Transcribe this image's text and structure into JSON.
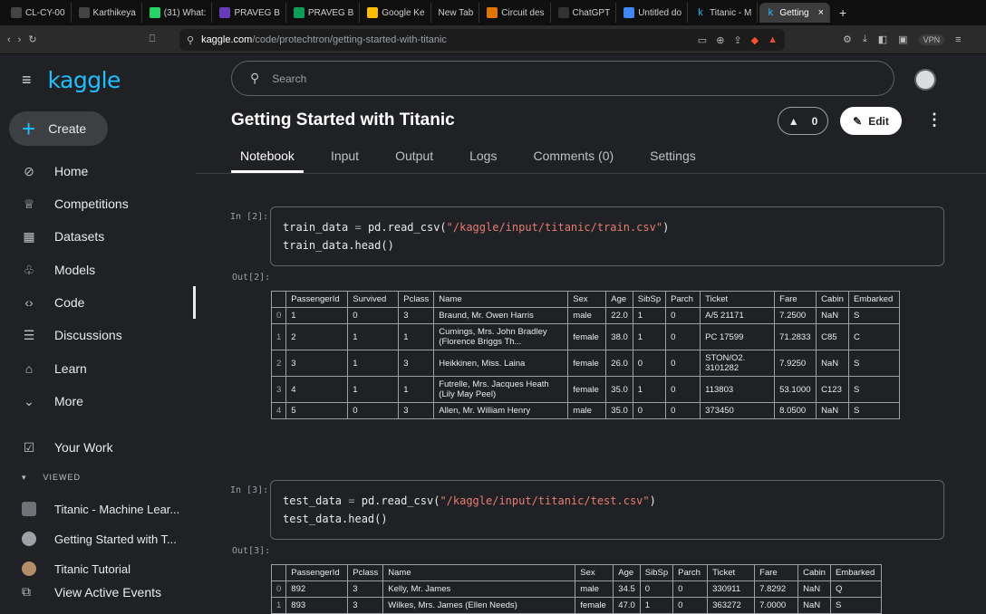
{
  "browser": {
    "tabs": [
      {
        "label": "CL-CY-00",
        "icon": "github-icon",
        "color": "#444"
      },
      {
        "label": "Karthikeya",
        "icon": "github-icon",
        "color": "#444"
      },
      {
        "label": "(31) What:",
        "icon": "whatsapp-icon",
        "color": "#25d366"
      },
      {
        "label": "PRAVEG B",
        "icon": "forms-icon",
        "color": "#673ab7"
      },
      {
        "label": "PRAVEG B",
        "icon": "sheets-icon",
        "color": "#0f9d58"
      },
      {
        "label": "Google Ke",
        "icon": "keep-icon",
        "color": "#fbbc04"
      },
      {
        "label": "New Tab",
        "icon": "",
        "color": ""
      },
      {
        "label": "Circuit des",
        "icon": "circuit-icon",
        "color": "#e37400"
      },
      {
        "label": "ChatGPT",
        "icon": "chatgpt-icon",
        "color": "#333"
      },
      {
        "label": "Untitled do",
        "icon": "docs-icon",
        "color": "#4285f4"
      },
      {
        "label": "Titanic - M",
        "icon": "kaggle-icon",
        "color": ""
      },
      {
        "label": "Getting",
        "icon": "kaggle-icon",
        "color": ""
      }
    ],
    "url_host": "kaggle.com",
    "url_path": "/code/protechtron/getting-started-with-titanic",
    "vpn_label": "VPN"
  },
  "sidebar": {
    "logo": "kaggle",
    "create_label": "Create",
    "items": [
      {
        "label": "Home",
        "icon": "compass-icon",
        "glyph": "⊘"
      },
      {
        "label": "Competitions",
        "icon": "trophy-icon",
        "glyph": "♕"
      },
      {
        "label": "Datasets",
        "icon": "table-icon",
        "glyph": "▦"
      },
      {
        "label": "Models",
        "icon": "models-icon",
        "glyph": "♧"
      },
      {
        "label": "Code",
        "icon": "code-icon",
        "glyph": "‹›"
      },
      {
        "label": "Discussions",
        "icon": "discussion-icon",
        "glyph": "☰"
      },
      {
        "label": "Learn",
        "icon": "learn-icon",
        "glyph": "⌂"
      },
      {
        "label": "More",
        "icon": "chevron-down-icon",
        "glyph": "⌄"
      }
    ],
    "your_work": "Your Work",
    "viewed_label": "VIEWED",
    "recent": [
      "Titanic - Machine Lear...",
      "Getting Started with T...",
      "Titanic Tutorial",
      "View Active Events"
    ]
  },
  "main": {
    "search_placeholder": "Search",
    "title": "Getting Started with Titanic",
    "vote_count": "0",
    "edit_label": "Edit",
    "tabs": [
      "Notebook",
      "Input",
      "Output",
      "Logs",
      "Comments (0)",
      "Settings"
    ],
    "cells": [
      {
        "in_prompt": "In [2]:",
        "out_prompt": "Out[2]:",
        "code_line1_var": "train_data",
        "code_line1_fn": "pd.read_csv(",
        "code_line1_str": "\"/kaggle/input/titanic/train.csv\"",
        "code_line2": "train_data.head()"
      },
      {
        "in_prompt": "In [3]:",
        "out_prompt": "Out[3]:",
        "code_line1_var": "test_data",
        "code_line1_fn": "pd.read_csv(",
        "code_line1_str": "\"/kaggle/input/titanic/test.csv\"",
        "code_line2": "test_data.head()"
      }
    ],
    "train_table": {
      "columns": [
        "",
        "PassengerId",
        "Survived",
        "Pclass",
        "Name",
        "Sex",
        "Age",
        "SibSp",
        "Parch",
        "Ticket",
        "Fare",
        "Cabin",
        "Embarked"
      ],
      "rows": [
        [
          "0",
          "1",
          "0",
          "3",
          "Braund, Mr. Owen Harris",
          "male",
          "22.0",
          "1",
          "0",
          "A/5 21171",
          "7.2500",
          "NaN",
          "S"
        ],
        [
          "1",
          "2",
          "1",
          "1",
          "Cumings, Mrs. John Bradley (Florence Briggs Th...",
          "female",
          "38.0",
          "1",
          "0",
          "PC 17599",
          "71.2833",
          "C85",
          "C"
        ],
        [
          "2",
          "3",
          "1",
          "3",
          "Heikkinen, Miss. Laina",
          "female",
          "26.0",
          "0",
          "0",
          "STON/O2. 3101282",
          "7.9250",
          "NaN",
          "S"
        ],
        [
          "3",
          "4",
          "1",
          "1",
          "Futrelle, Mrs. Jacques Heath (Lily May Peel)",
          "female",
          "35.0",
          "1",
          "0",
          "113803",
          "53.1000",
          "C123",
          "S"
        ],
        [
          "4",
          "5",
          "0",
          "3",
          "Allen, Mr. William Henry",
          "male",
          "35.0",
          "0",
          "0",
          "373450",
          "8.0500",
          "NaN",
          "S"
        ]
      ]
    },
    "test_table": {
      "columns": [
        "",
        "PassengerId",
        "Pclass",
        "Name",
        "Sex",
        "Age",
        "SibSp",
        "Parch",
        "Ticket",
        "Fare",
        "Cabin",
        "Embarked"
      ],
      "rows": [
        [
          "0",
          "892",
          "3",
          "Kelly, Mr. James",
          "male",
          "34.5",
          "0",
          "0",
          "330911",
          "7.8292",
          "NaN",
          "Q"
        ],
        [
          "1",
          "893",
          "3",
          "Wilkes, Mrs. James (Ellen Needs)",
          "female",
          "47.0",
          "1",
          "0",
          "363272",
          "7.0000",
          "NaN",
          "S"
        ]
      ]
    }
  }
}
